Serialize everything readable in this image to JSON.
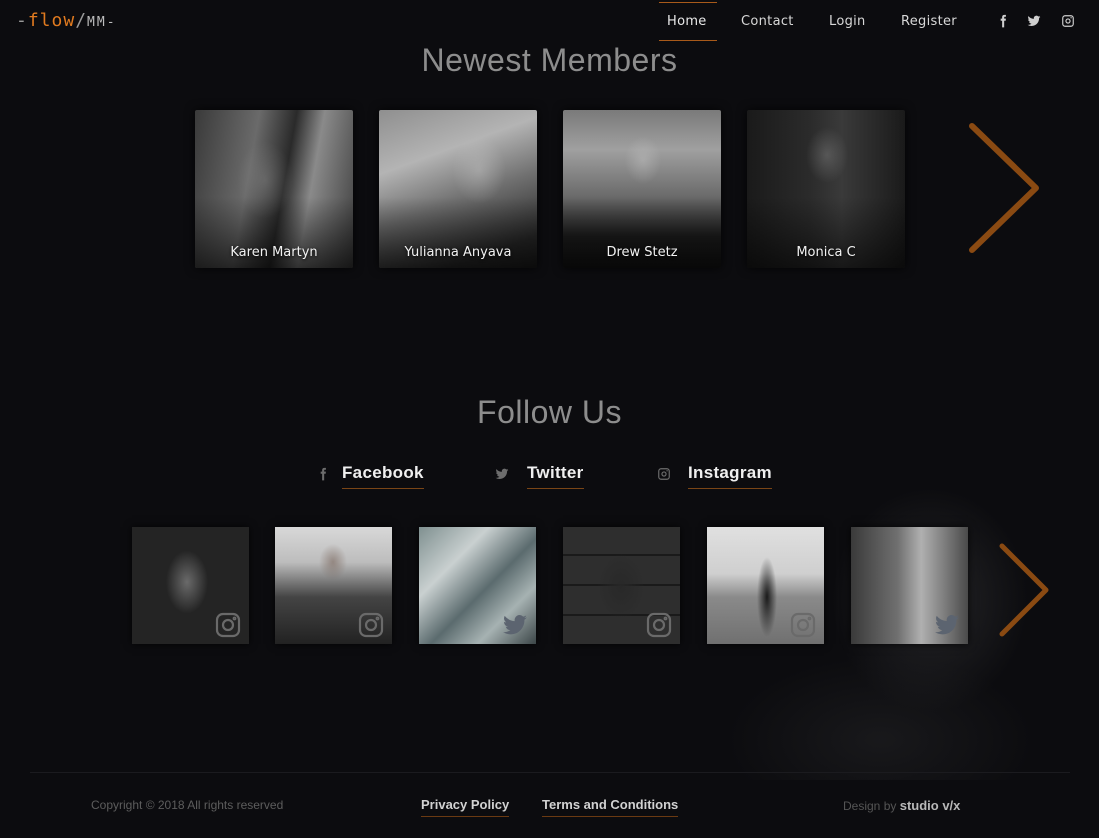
{
  "brand": {
    "prefix": "-",
    "name": "flow",
    "slash": "/",
    "suffix": "MM-"
  },
  "nav": {
    "items": [
      {
        "label": "Home",
        "active": true
      },
      {
        "label": "Contact"
      },
      {
        "label": "Login"
      },
      {
        "label": "Register"
      }
    ],
    "social_icons": [
      "facebook-icon",
      "twitter-icon",
      "instagram-icon"
    ]
  },
  "members": {
    "title": "Newest Members",
    "items": [
      {
        "name": "Karen Martyn"
      },
      {
        "name": "Yulianna Anyava"
      },
      {
        "name": "Drew Stetz"
      },
      {
        "name": "Monica C"
      }
    ],
    "next_icon": "chevron-right-icon"
  },
  "follow": {
    "title": "Follow Us",
    "links": [
      {
        "label": "Facebook",
        "icon": "facebook-icon"
      },
      {
        "label": "Twitter",
        "icon": "twitter-icon"
      },
      {
        "label": "Instagram",
        "icon": "instagram-icon"
      }
    ],
    "gallery": [
      {
        "source_icon": "instagram-icon"
      },
      {
        "source_icon": "instagram-icon"
      },
      {
        "source_icon": "twitter-icon"
      },
      {
        "source_icon": "instagram-icon"
      },
      {
        "source_icon": "instagram-icon"
      },
      {
        "source_icon": "twitter-icon"
      }
    ]
  },
  "footer": {
    "copyright": "Copyright © 2018 All rights reserved",
    "links": [
      "Privacy Policy",
      "Terms and Conditions"
    ],
    "design_prefix": "Design by",
    "design_studio": "studio v/x"
  },
  "colors": {
    "accent": "#e07a1f",
    "arrow": "#8a4a12",
    "background": "#0c0c0f"
  }
}
